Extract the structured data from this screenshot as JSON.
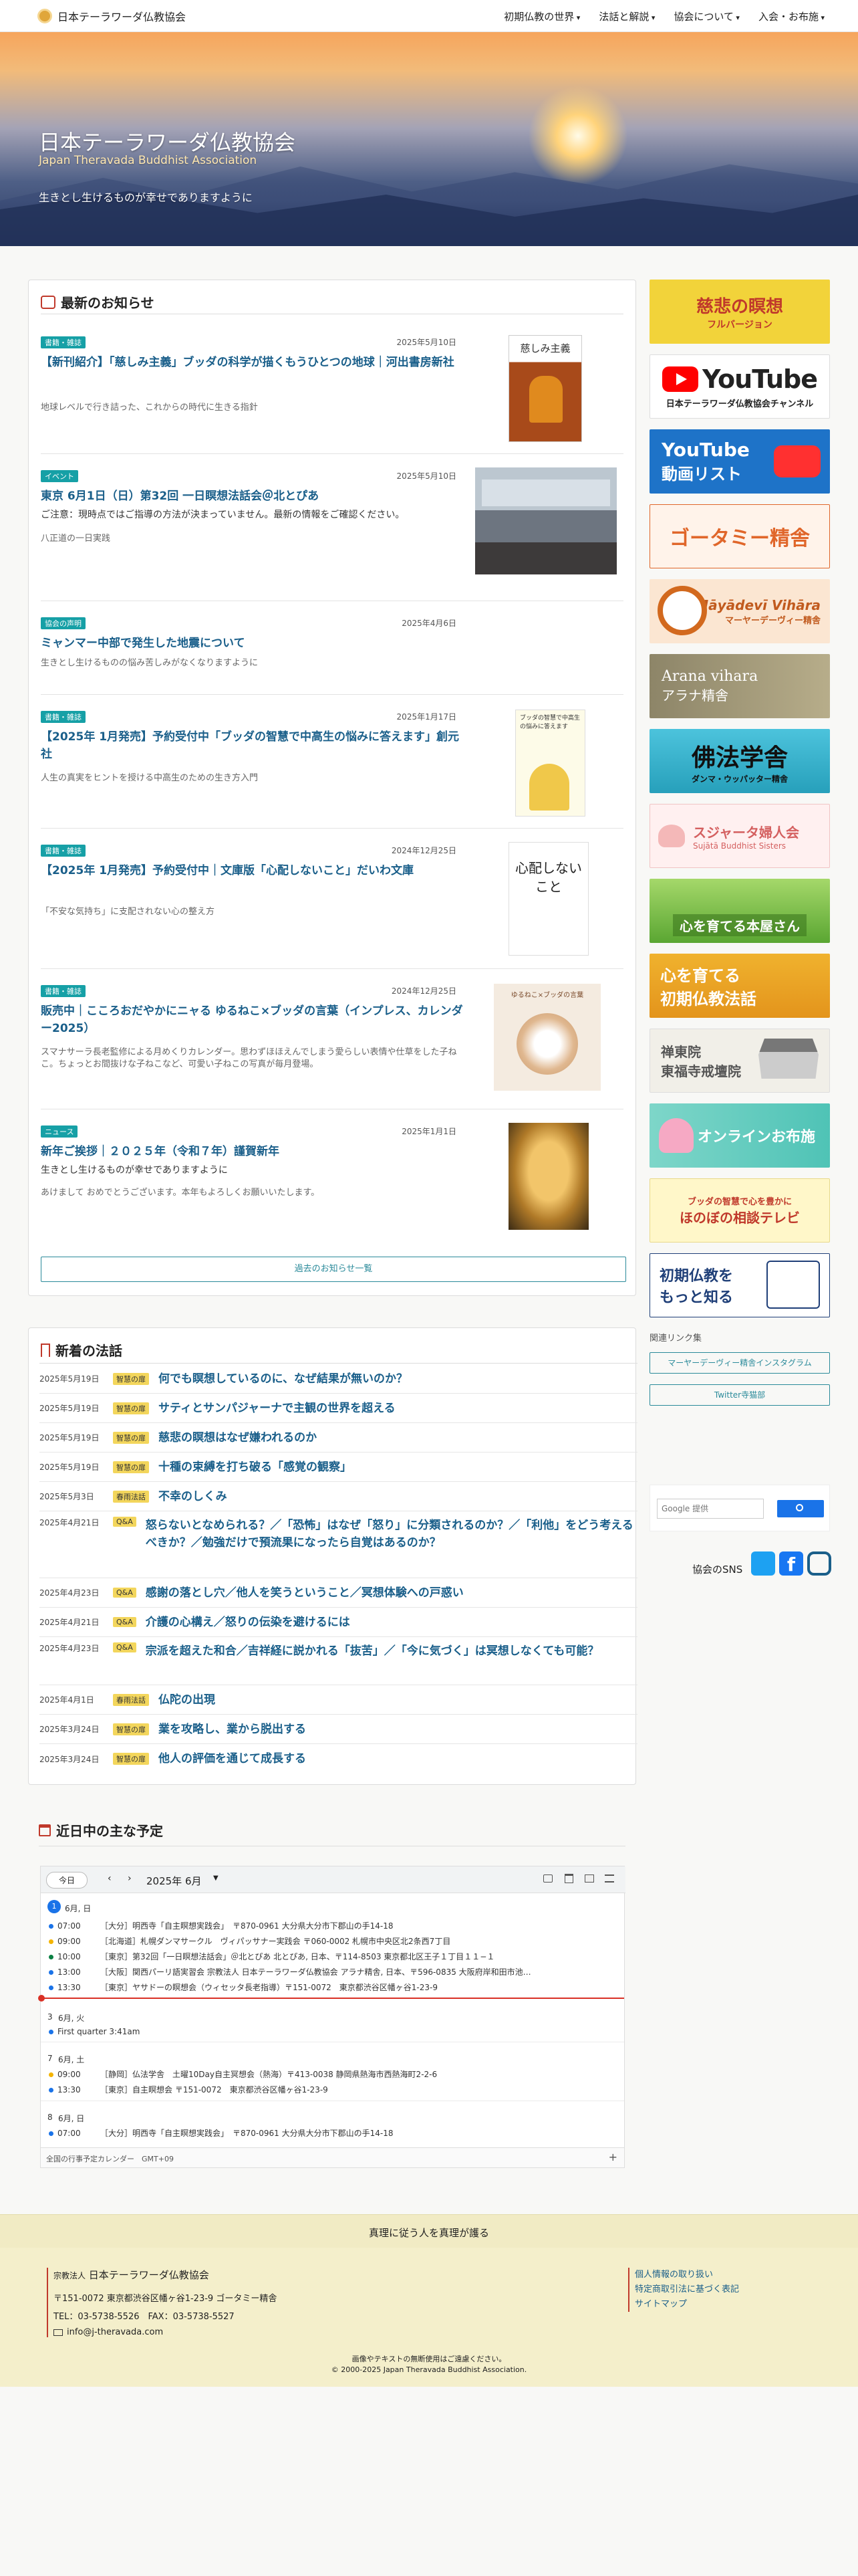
{
  "header": {
    "site_name": "日本テーラワーダ仏教協会",
    "nav": [
      "初期仏教の世界",
      "法話と解説",
      "協会について",
      "入会・お布施"
    ]
  },
  "hero": {
    "title": "日本テーラワーダ仏教協会",
    "subtitle": "Japan Theravada Buddhist Association",
    "tagline": "生きとし生けるものが幸せでありますように"
  },
  "news": {
    "heading": "最新のお知らせ",
    "more_button": "過去のお知らせ一覧",
    "items": [
      {
        "badge": "書籍・雑誌",
        "date": "2025年5月10日",
        "title": "【新刊紹介】「慈しみ主義」ブッダの科学が描くもうひとつの地球｜河出書房新社",
        "desc": "地球レベルで行き詰った、これからの時代に生きる指針",
        "desc2": ""
      },
      {
        "badge": "イベント",
        "date": "2025年5月10日",
        "title": "東京 6月1日（日）第32回 一日瞑想法話会＠北とぴあ",
        "desc": "ご注意：現時点ではご指導の方法が決まっていません。最新の情報をご確認ください。",
        "desc2": "八正道の一日実践"
      },
      {
        "badge": "協会の声明",
        "date": "2025年4月6日",
        "title": "ミャンマー中部で発生した地震について",
        "desc": "生きとし生けるものの悩み苦しみがなくなりますように",
        "desc2": ""
      },
      {
        "badge": "書籍・雑誌",
        "date": "2025年1月17日",
        "title": "【2025年 1月発売】予約受付中「ブッダの智慧で中高生の悩みに答えます」創元社",
        "desc": "人生の真実をヒントを授ける中高生のための生き方入門",
        "desc2": ""
      },
      {
        "badge": "書籍・雑誌",
        "date": "2024年12月25日",
        "title": "【2025年 1月発売】予約受付中｜文庫版「心配しないこと」だいわ文庫",
        "desc": "「不安な気持ち」に支配されない心の整え方",
        "desc2": ""
      },
      {
        "badge": "書籍・雑誌",
        "date": "2024年12月25日",
        "title": "販売中｜こころおだやかにニャる ゆるねこ×ブッダの言葉（インプレス、カレンダー2025）",
        "desc": "スマナサーラ長老監修による月めくりカレンダー。思わずほほえんでしまう愛らしい表情や仕草をした子ねこ。ちょっとお間抜けな子ねこなど、可愛い子ねこの写真が毎月登場。",
        "desc2": ""
      },
      {
        "badge": "ニュース",
        "date": "2025年1月1日",
        "title": "新年ご挨拶｜２０２５年（令和７年）謹賀新年",
        "desc": "生きとし生けるものが幸せでありますように",
        "desc2": "あけまして おめでとうございます。本年もよろしくお願いいたします。"
      }
    ],
    "thumbs": [
      "慈しみ主義",
      "",
      "",
      "ブッダの智慧で中高生の悩みに答えます",
      "心配しないこと",
      "ゆるねこ×ブッダの言葉",
      ""
    ]
  },
  "dharma": {
    "heading": "新着の法話",
    "items": [
      {
        "date": "2025年5月19日",
        "tag": "智慧の扉",
        "title": "何でも瞑想しているのに、なぜ結果が無いのか？"
      },
      {
        "date": "2025年5月19日",
        "tag": "智慧の扉",
        "title": "サティとサンパジャーナで主観の世界を超える"
      },
      {
        "date": "2025年5月19日",
        "tag": "智慧の扉",
        "title": "慈悲の瞑想はなぜ嫌われるのか"
      },
      {
        "date": "2025年5月19日",
        "tag": "智慧の扉",
        "title": "十種の束縛を打ち破る「感覚の観察」"
      },
      {
        "date": "2025年5月3日",
        "tag": "春雨法話",
        "title": "不幸のしくみ"
      },
      {
        "date": "2025年4月21日",
        "tag": "Q&A",
        "title": "怒らないとなめられる？／「恐怖」はなぜ「怒り」に分類されるのか？／「利他」をどう考えるべきか？／勉強だけで預流果になったら自覚はあるのか？"
      },
      {
        "date": "2025年4月23日",
        "tag": "Q&A",
        "title": "感謝の落とし穴／他人を笑うということ／冥想体験への戸惑い"
      },
      {
        "date": "2025年4月21日",
        "tag": "Q&A",
        "title": "介護の心構え／怒りの伝染を避けるには"
      },
      {
        "date": "2025年4月23日",
        "tag": "Q&A",
        "title": "宗派を超えた和合／吉祥経に説かれる「抜苦」／「今に気づく」は冥想しなくても可能？"
      },
      {
        "date": "2025年4月1日",
        "tag": "春雨法話",
        "title": "仏陀の出現"
      },
      {
        "date": "2025年3月24日",
        "tag": "智慧の扉",
        "title": "業を攻略し、業から脱出する"
      },
      {
        "date": "2025年3月24日",
        "tag": "智慧の扉",
        "title": "他人の評価を通じて成長する"
      }
    ]
  },
  "schedule": {
    "heading": "近日中の主な予定",
    "today_button": "今日",
    "month": "2025年 6月",
    "timezone": "全国の行事予定カレンダー　GMT+09",
    "days": [
      {
        "label": "6月, 日",
        "events": [
          {
            "time": "07:00",
            "text": "［大分］明西寺「自主瞑想実践会」　〒870-0961 大分県大分市下郡山の手14-18"
          },
          {
            "time": "09:00",
            "text": "［北海道］札幌ダンマサークル　ヴィパッサナー実践会 〒060-0002 札幌市中央区北2条西7丁目"
          },
          {
            "time": "10:00",
            "text": "［東京］第32回「一日瞑想法話会」＠北とぴあ 北とぴあ, 日本、〒114-8503 東京都北区王子１丁目１１−１"
          },
          {
            "time": "13:00",
            "text": "［大阪］関西パーリ語実習会 宗教法人 日本テーラワーダ仏教協会 アラナ精舎, 日本、〒596-0835 大阪府岸和田市池…"
          },
          {
            "time": "13:30",
            "text": "［東京］ヤサドーの瞑想会（ウィセッタ長老指導）〒151-0072　東京都渋谷区幡ヶ谷1-23-9"
          }
        ]
      },
      {
        "label": "6月, 火",
        "events": [
          {
            "time": "",
            "text": "First quarter 3:41am"
          }
        ]
      },
      {
        "label": "6月, 土",
        "events": [
          {
            "time": "09:00",
            "text": "［静岡］仏法学舎　土曜10Day自主冥想会（熱海）〒413-0038 静岡県熱海市西熱海町2-2-6"
          },
          {
            "time": "13:30",
            "text": "［東京］自主瞑想会 〒151-0072　東京都渋谷区幡ヶ谷1-23-9"
          }
        ]
      },
      {
        "label": "6月, 日",
        "events": [
          {
            "time": "07:00",
            "text": "［大分］明西寺「自主瞑想実践会」　〒870-0961 大分県大分市下郡山の手14-18"
          }
        ]
      }
    ]
  },
  "sidebar": {
    "banners": [
      {
        "label": "慈悲の瞑想",
        "sub": "フルバージョン",
        "bg": "#f2d33a",
        "fg": "#c0392b"
      },
      {
        "label": "YouTube",
        "sub": "日本テーラワーダ仏教協会チャンネル",
        "bg": "#ffffff",
        "fg": "#222222"
      },
      {
        "label": "YouTube",
        "sub": "動画リスト",
        "bg": "#1e73c8",
        "fg": "#ffffff"
      },
      {
        "label": "ゴータミー精舎",
        "sub": "",
        "bg": "#fff3ea",
        "fg": "#e0662a"
      },
      {
        "label": "Māyādevī Vihāra",
        "sub": "マーヤーデーヴィー精舎",
        "bg": "#fbe6d2",
        "fg": "#c15a1e"
      },
      {
        "label": "Arana vihara",
        "sub": "アラナ精舎",
        "bg": "#9b9073",
        "fg": "#ffffff"
      },
      {
        "label": "佛法学舎",
        "sub": "ダンマ・ウッパッター精舎",
        "bg": "#3cb3d0",
        "fg": "#111111"
      },
      {
        "label": "スジャータ婦人会",
        "sub": "Sujātā Buddhist Sisters",
        "bg": "#fff0f0",
        "fg": "#d46060"
      },
      {
        "label": "心を育てる本屋さん",
        "sub": "",
        "bg": "#7cbd4a",
        "fg": "#ffffff"
      },
      {
        "label": "心を育てる",
        "sub": "初期仏教法話",
        "bg": "#e8a82a",
        "fg": "#ffffff"
      },
      {
        "label": "禅東院",
        "sub": "東福寺戒壇院",
        "bg": "#f1efe8",
        "fg": "#555555"
      },
      {
        "label": "オンラインお布施",
        "sub": "",
        "bg": "#6fd0c6",
        "fg": "#ffffff"
      },
      {
        "label": "ほのぼの相談テレビ",
        "sub": "ブッダの智慧で心を豊かに",
        "bg": "#fff7c9",
        "fg": "#c0392b"
      },
      {
        "label": "初期仏教を",
        "sub": "もっと知る",
        "bg": "#ffffff",
        "fg": "#1f3f78"
      }
    ],
    "links_heading": "関連リンク集",
    "link_buttons": [
      "マーヤーデーヴィー精舎インスタグラム",
      "Twitter寺猫部"
    ],
    "search_placeholder": "Google 提供",
    "sns_label": "協会のSNS"
  },
  "footer": {
    "motto": "真理に従う人を真理が護る",
    "org_type": "宗教法人",
    "org_name": "日本テーラワーダ仏教協会",
    "address": "〒151-0072 東京都渋谷区幡ヶ谷1-23-9 ゴータミー精舎",
    "phone": "TEL：03-5738-5526　FAX：03-5738-5527",
    "email": "info@j-theravada.com",
    "links": [
      "個人情報の取り扱い",
      "特定商取引法に基づく表記",
      "サイトマップ"
    ],
    "notice": "画像やテキストの無断使用はご遠慮ください。",
    "copyright": "© 2000-2025 Japan Theravada Buddhist Association."
  }
}
